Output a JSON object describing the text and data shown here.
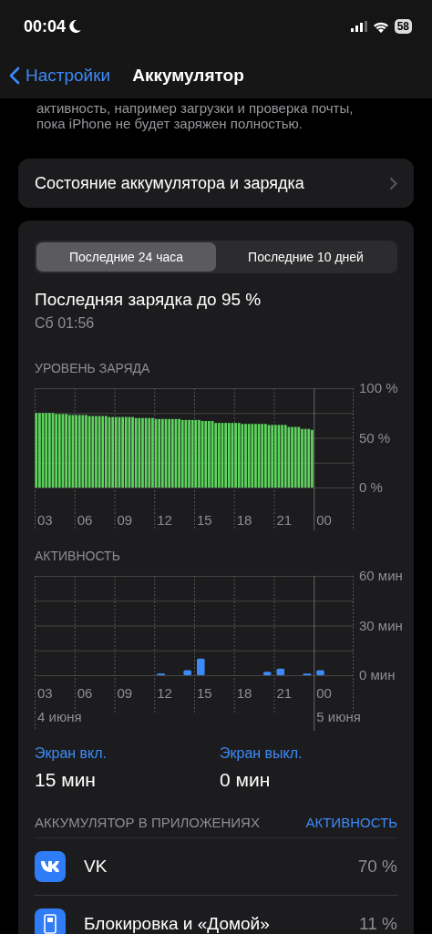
{
  "status_bar": {
    "time": "00:04",
    "battery": "58"
  },
  "nav": {
    "back": "Настройки",
    "title": "Аккумулятор"
  },
  "intro_text": [
    "активность, например загрузки и проверка почты,",
    "пока iPhone не будет заряжен полностью."
  ],
  "health_row": {
    "label": "Состояние аккумулятора и зарядка"
  },
  "tabs": [
    {
      "label": "Последние 24 часа",
      "selected": true
    },
    {
      "label": "Последние 10 дней",
      "selected": false
    }
  ],
  "last_charge": {
    "title": "Последняя зарядка до 95 %",
    "time": "Сб 01:56"
  },
  "battery_level": {
    "header": "УРОВЕНЬ ЗАРЯДА",
    "hour_labels": [
      "03",
      "06",
      "09",
      "12",
      "15",
      "18",
      "21",
      "00"
    ],
    "chart_data": {
      "type": "bar",
      "color": "#5ed35e",
      "ylim": [
        0,
        100
      ],
      "yticks": [
        {
          "value": 0,
          "label": "0 %"
        },
        {
          "value": 50,
          "label": "50 %"
        },
        {
          "value": 100,
          "label": "100 %"
        }
      ],
      "values": [
        75,
        75,
        75,
        75,
        75,
        75,
        74,
        74,
        74,
        74,
        73,
        73,
        73,
        73,
        73,
        73,
        72,
        72,
        72,
        72,
        72,
        72,
        71,
        71,
        71,
        71,
        71,
        71,
        71,
        71,
        70,
        70,
        70,
        70,
        70,
        70,
        69,
        69,
        69,
        69,
        69,
        69,
        69,
        69,
        68,
        68,
        68,
        68,
        68,
        68,
        67,
        67,
        67,
        67,
        65,
        65,
        65,
        65,
        65,
        65,
        65,
        65,
        64,
        64,
        64,
        64,
        64,
        64,
        64,
        64,
        63,
        63,
        63,
        63,
        63,
        63,
        61,
        61,
        61,
        61,
        59,
        59,
        59,
        58
      ]
    }
  },
  "activity": {
    "header": "АКТИВНОСТЬ",
    "hour_labels": [
      "03",
      "06",
      "09",
      "12",
      "15",
      "18",
      "21",
      "00"
    ],
    "chart_data": {
      "type": "bar",
      "color": "#3d8af7",
      "ylim": [
        0,
        60
      ],
      "yticks": [
        {
          "value": 0,
          "label": "0 мин"
        },
        {
          "value": 30,
          "label": "30 мин"
        },
        {
          "value": 60,
          "label": "60 мин"
        }
      ],
      "values": [
        0,
        0,
        0,
        0,
        0,
        0,
        0,
        0,
        0,
        1,
        0,
        3,
        10,
        0,
        0,
        0,
        0,
        2,
        4,
        0,
        1,
        3,
        null,
        null
      ]
    },
    "dates": [
      "4 июня",
      "5 июня"
    ]
  },
  "screen_stats": [
    {
      "label": "Экран вкл.",
      "value": "15 мин"
    },
    {
      "label": "Экран выкл.",
      "value": "0 мин"
    }
  ],
  "apps": {
    "header": "АККУМУЛЯТОР В ПРИЛОЖЕНИЯХ",
    "toggle": "АКТИВНОСТЬ",
    "items": [
      {
        "name": "VK",
        "percent": "70 %",
        "kind": "vk"
      },
      {
        "name": "Блокировка и «Домой»",
        "percent": "11 %",
        "kind": "phone"
      }
    ]
  }
}
